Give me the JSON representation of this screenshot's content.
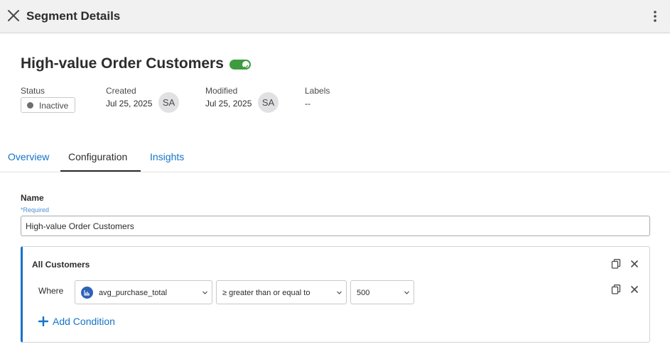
{
  "header": {
    "title": "Segment Details",
    "close_icon": "close-icon",
    "more_icon": "vertical-ellipsis-icon"
  },
  "segment": {
    "title": "High-value Order Customers",
    "enabled": true,
    "status": {
      "label": "Status",
      "value": "Inactive"
    },
    "created": {
      "label": "Created",
      "date": "Jul 25, 2025",
      "initials": "SA"
    },
    "modified": {
      "label": "Modified",
      "date": "Jul 25, 2025",
      "initials": "SA"
    },
    "labels": {
      "label": "Labels",
      "value": "--"
    }
  },
  "tabs": [
    {
      "label": "Overview",
      "active": false
    },
    {
      "label": "Configuration",
      "active": true
    },
    {
      "label": "Insights",
      "active": false
    }
  ],
  "form": {
    "name_label": "Name",
    "required_text": "*Required",
    "name_value": "High-value Order Customers"
  },
  "rule": {
    "title": "All Customers",
    "where_label": "Where",
    "attribute": "avg_purchase_total",
    "attribute_icon": "bar-chart-icon",
    "operator": "≥ greater than or equal to",
    "value": "500",
    "add_condition": "Add Condition"
  },
  "colors": {
    "accent": "#1473c9",
    "toggle_on": "#3e9b3f",
    "status_dot": "#6e6e6e",
    "header_bg": "#f1f1f2"
  }
}
